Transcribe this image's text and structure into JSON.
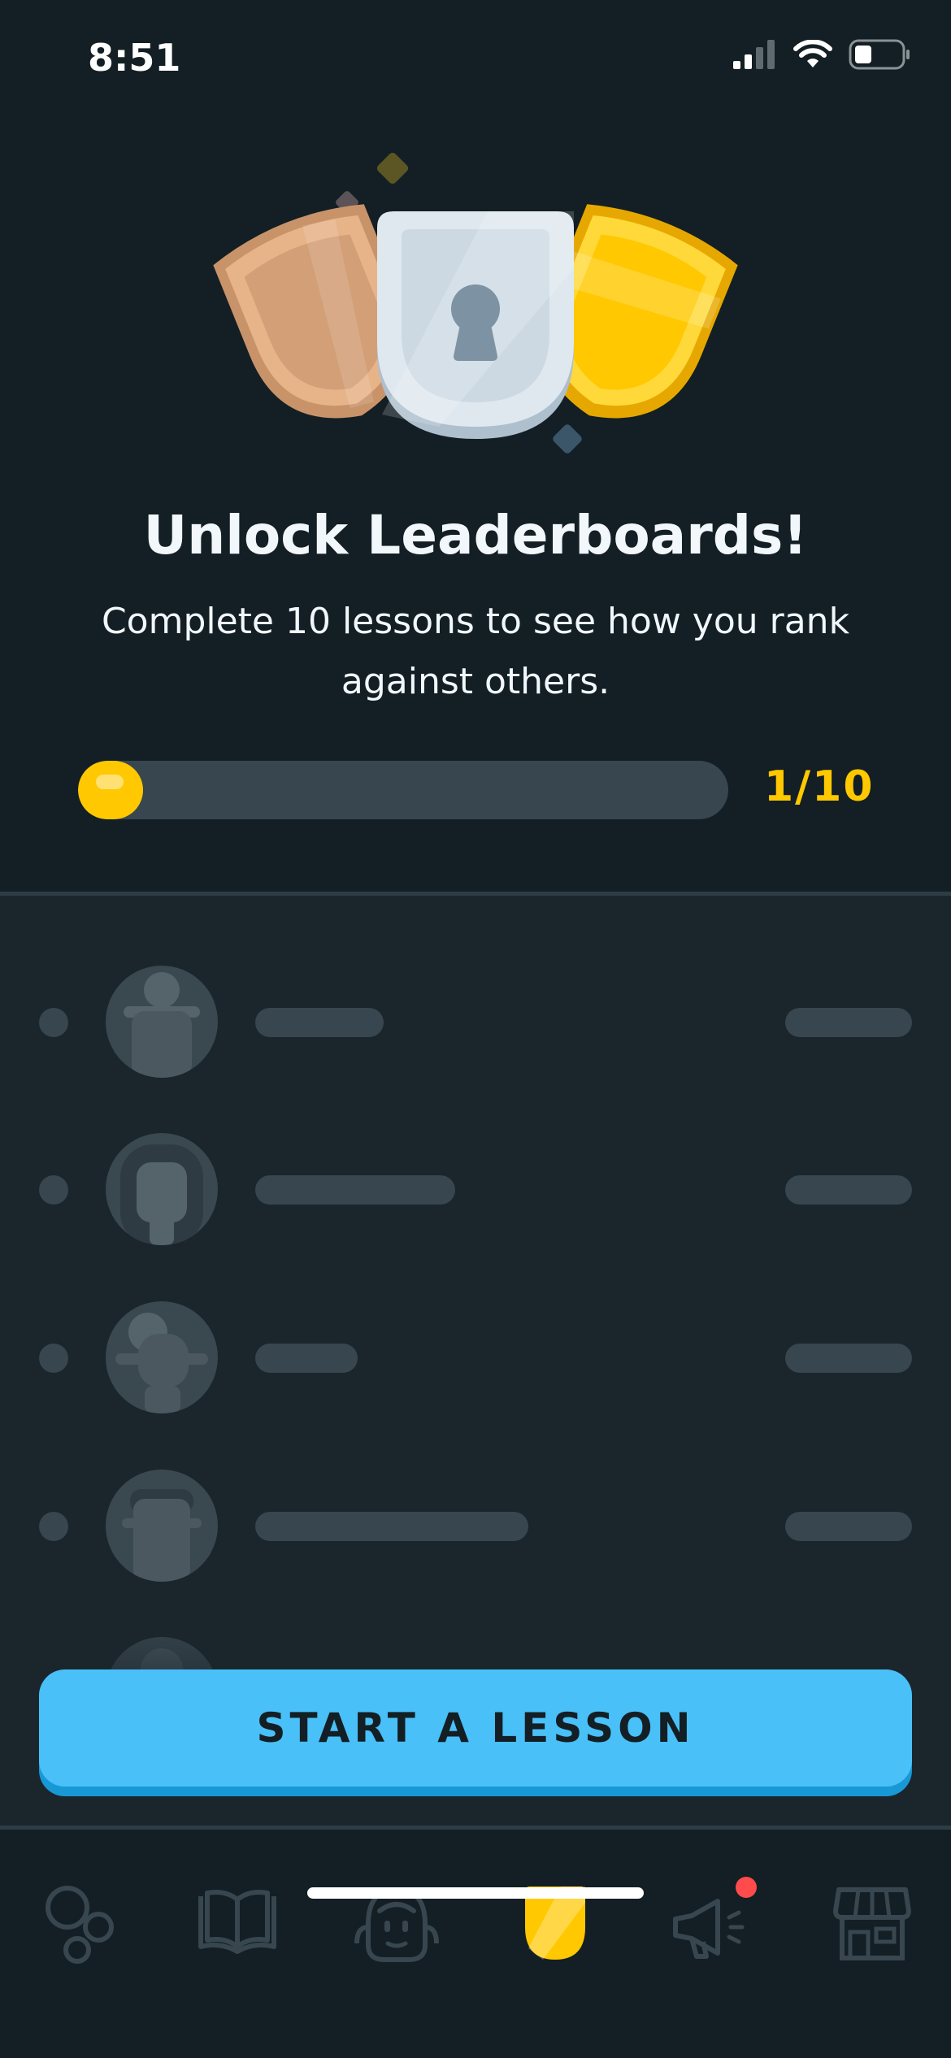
{
  "status_bar": {
    "time": "8:51",
    "signal_icon": "cellular-signal-icon",
    "wifi_icon": "wifi-icon",
    "battery_icon": "battery-icon"
  },
  "hero": {
    "left_shield": "bronze-shield-icon",
    "center_shield": "silver-lock-shield-icon",
    "right_shield": "gold-shield-icon"
  },
  "title": "Unlock Leaderboards!",
  "subtitle": "Complete 10 lessons to see how you rank against others.",
  "progress": {
    "count_label": "1/10",
    "completed": 1,
    "total": 10
  },
  "cta": {
    "label": "START A LESSON"
  },
  "tabs": [
    {
      "icon": "learn-circles-icon"
    },
    {
      "icon": "book-icon"
    },
    {
      "icon": "character-face-icon"
    },
    {
      "icon": "leaderboard-shield-icon",
      "selected": true
    },
    {
      "icon": "megaphone-icon",
      "has_badge": true
    },
    {
      "icon": "shop-icon"
    }
  ],
  "colors": {
    "background": "#131f24",
    "accent_gold": "#ffc800",
    "cta_blue": "#49c0f8",
    "badge_red": "#ff4b4b"
  }
}
